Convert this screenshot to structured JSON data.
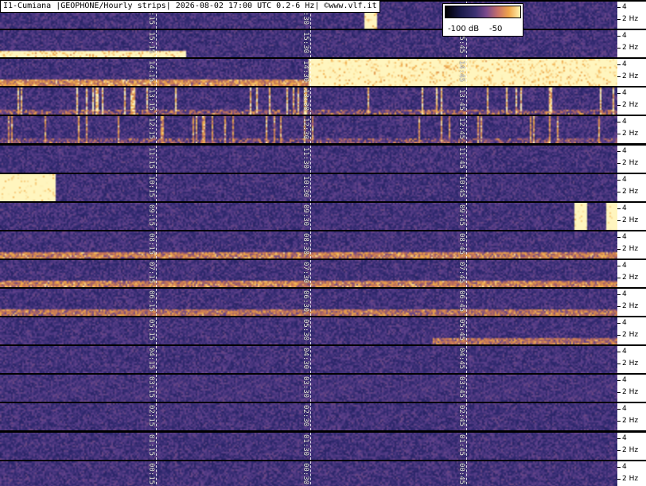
{
  "header": {
    "title": "I1-Cumiana |GEOPHONE/Hourly strips| 2026-08-02 17:00 UTC 0.2-6 Hz| ©www.vlf.it"
  },
  "legend": {
    "low_label": "-100 dB",
    "high_label": "-50"
  },
  "axis": {
    "tick_upper": "4",
    "tick_lower": "2 Hz"
  },
  "strips": [
    {
      "hour": "16",
      "marks": [
        "16:15",
        "16:30",
        "16:45"
      ],
      "events": [
        {
          "pos": 0.59,
          "w": 0.02,
          "i": 0.9,
          "band": "full"
        }
      ]
    },
    {
      "hour": "15",
      "marks": [
        "15:15",
        "15:30",
        "15:45"
      ],
      "events": [
        {
          "pos": 0.0,
          "w": 0.3,
          "i": 0.9,
          "band": "low"
        }
      ]
    },
    {
      "hour": "14",
      "marks": [
        "14:15",
        "14:30",
        "14:45"
      ],
      "events": [
        {
          "pos": 0.5,
          "w": 0.5,
          "i": 0.9,
          "band": "full"
        },
        {
          "pos": 0.0,
          "w": 0.5,
          "i": 0.5,
          "band": "low"
        }
      ]
    },
    {
      "hour": "13",
      "marks": [
        "13:15",
        "13:30",
        "13:45"
      ],
      "events": [
        {
          "pos": 0.0,
          "w": 1.0,
          "i": 0.7,
          "band": "spikes"
        }
      ]
    },
    {
      "hour": "12",
      "marks": [
        "12:15",
        "12:30",
        "12:45"
      ],
      "events": [
        {
          "pos": 0.0,
          "w": 1.0,
          "i": 0.55,
          "band": "spikes"
        }
      ]
    },
    {
      "hour": "11",
      "marks": [
        "11:15",
        "11:30",
        "11:45"
      ],
      "events": []
    },
    {
      "hour": "10",
      "marks": [
        "10:15",
        "10:30",
        "10:45"
      ],
      "events": [
        {
          "pos": 0.0,
          "w": 0.09,
          "i": 1.0,
          "band": "full"
        }
      ]
    },
    {
      "hour": "09",
      "marks": [
        "09:15",
        "09:30",
        "09:45"
      ],
      "events": [
        {
          "pos": 0.93,
          "w": 0.02,
          "i": 1.0,
          "band": "full"
        },
        {
          "pos": 0.98,
          "w": 0.02,
          "i": 1.0,
          "band": "full"
        }
      ]
    },
    {
      "hour": "08",
      "marks": [
        "08:15",
        "08:30",
        "08:45"
      ],
      "events": [
        {
          "pos": 0.0,
          "w": 1.0,
          "i": 0.45,
          "band": "low"
        }
      ]
    },
    {
      "hour": "07",
      "marks": [
        "07:15",
        "07:30",
        "07:45"
      ],
      "events": [
        {
          "pos": 0.0,
          "w": 1.0,
          "i": 0.45,
          "band": "low"
        }
      ]
    },
    {
      "hour": "06",
      "marks": [
        "06:15",
        "06:30",
        "06:45"
      ],
      "events": [
        {
          "pos": 0.0,
          "w": 1.0,
          "i": 0.4,
          "band": "low"
        }
      ]
    },
    {
      "hour": "05",
      "marks": [
        "05:15",
        "05:30",
        "05:45"
      ],
      "events": [
        {
          "pos": 0.7,
          "w": 0.3,
          "i": 0.4,
          "band": "low"
        }
      ]
    },
    {
      "hour": "04",
      "marks": [
        "04:15",
        "04:30",
        "04:45"
      ],
      "events": []
    },
    {
      "hour": "03",
      "marks": [
        "03:15",
        "03:30",
        "03:45"
      ],
      "events": []
    },
    {
      "hour": "02",
      "marks": [
        "02:15",
        "02:30",
        "02:45"
      ],
      "events": []
    },
    {
      "hour": "01",
      "marks": [
        "01:15",
        "01:30",
        "01:45"
      ],
      "events": []
    },
    {
      "hour": "00",
      "marks": [
        "00:15",
        "00:30",
        "00:45"
      ],
      "events": []
    }
  ]
}
